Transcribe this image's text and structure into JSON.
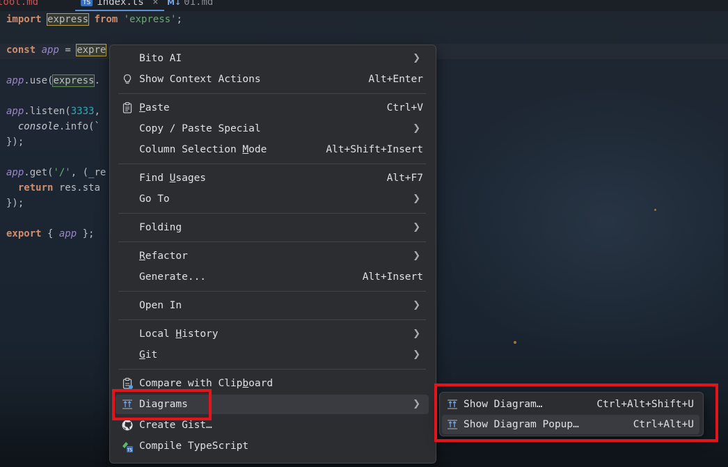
{
  "tabs": [
    {
      "label": "tool.md"
    },
    {
      "badge": "TS",
      "label": "index.ts",
      "close": "×"
    },
    {
      "badge": "M↓",
      "label": "01.md"
    }
  ],
  "code": {
    "l1": {
      "kw1": "import",
      "id": "express",
      "kw2": "from",
      "str": "'express'",
      "end": ";"
    },
    "l2": {
      "kw": "const",
      "var": "app",
      "eq": " = ",
      "hl": "expre"
    },
    "l3": {
      "var": "app",
      "mid": ".use(",
      "hl": "express",
      "end": "."
    },
    "l4": {
      "var": "app",
      "mid": ".listen(",
      "num": "3333",
      "end": ", "
    },
    "l5": {
      "obj": "console",
      "mid": ".info(`"
    },
    "l6": {
      "text": "});"
    },
    "l7": {
      "var": "app",
      "mid": ".get(",
      "str": "'/'",
      "end": ", (_re"
    },
    "l8": {
      "kw": "return",
      "mid": " res.sta"
    },
    "l9": {
      "text": "});"
    },
    "l10": {
      "kw": "export",
      "open": " { ",
      "var": "app",
      "close": " };"
    }
  },
  "menu": {
    "bito": {
      "label": "Bito AI"
    },
    "context": {
      "label": "Show Context Actions",
      "shortcut": "Alt+Enter"
    },
    "paste": {
      "p": "P",
      "rest": "aste",
      "shortcut": "Ctrl+V"
    },
    "copy_paste": {
      "label": "Copy / Paste Special"
    },
    "column": {
      "pre": "Column Selection ",
      "u": "M",
      "post": "ode",
      "shortcut": "Alt+Shift+Insert"
    },
    "find": {
      "pre": "Find ",
      "u": "U",
      "post": "sages",
      "shortcut": "Alt+F7"
    },
    "goto": {
      "label": "Go To"
    },
    "folding": {
      "label": "Folding"
    },
    "refactor": {
      "u": "R",
      "rest": "efactor"
    },
    "generate": {
      "label": "Generate...",
      "shortcut": "Alt+Insert"
    },
    "open_in": {
      "label": "Open In"
    },
    "history": {
      "pre": "Local ",
      "u": "H",
      "post": "istory"
    },
    "git": {
      "u": "G",
      "rest": "it"
    },
    "compare": {
      "pre": "Compare with Clip",
      "u": "b",
      "post": "oard"
    },
    "diagrams": {
      "label": "Diagrams"
    },
    "gist": {
      "label": "Create Gist…"
    },
    "compile": {
      "label": "Compile TypeScript"
    }
  },
  "submenu": {
    "show_diagram": {
      "label": "Show Diagram…",
      "shortcut": "Ctrl+Alt+Shift+U"
    },
    "show_popup": {
      "label": "Show Diagram Popup…",
      "shortcut": "Ctrl+Alt+U"
    }
  },
  "colors": {
    "highlight_box": "#e3151a",
    "menu_bg": "#2b2d30",
    "selected": "#393b40"
  }
}
